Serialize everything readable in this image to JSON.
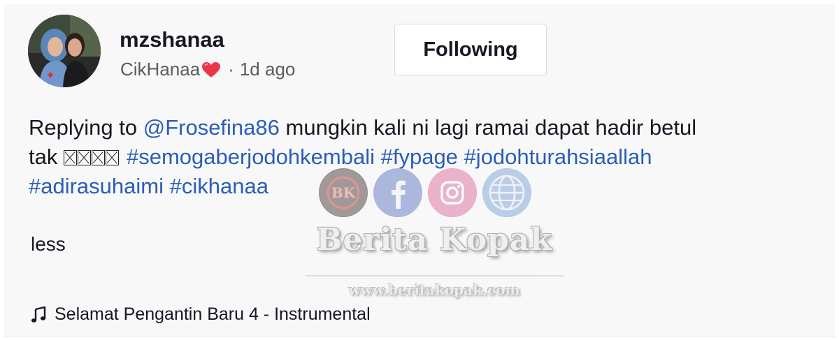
{
  "post": {
    "username": "mzshanaa",
    "display_name": "CikHanaa",
    "separator": "·",
    "time_ago": "1d ago",
    "follow_label": "Following"
  },
  "caption": {
    "line1": [
      {
        "type": "text",
        "text": "Replying to "
      },
      {
        "type": "mention",
        "text": "@Frosefina86"
      },
      {
        "type": "text",
        "text": " mungkin kali ni lagi ramai dapat hadir betul"
      }
    ],
    "line2_prefix": "tak ",
    "line2": [
      {
        "type": "hashtag",
        "text": "#semogaberjodohkembali"
      },
      {
        "type": "hashtag",
        "text": "#fypage"
      },
      {
        "type": "hashtag",
        "text": "#jodohturahsiaallah"
      }
    ],
    "line3": [
      {
        "type": "hashtag",
        "text": "#adirasuhaimi"
      },
      {
        "type": "hashtag",
        "text": "#cikhanaa"
      }
    ]
  },
  "less_label": "less",
  "music": {
    "icon": "music-note-icon",
    "title": "Selamat Pengantin Baru 4 - Instrumental"
  },
  "watermark": {
    "brand": "Berita Kopak",
    "url": "www.beritakopak.com",
    "badge": "BK"
  },
  "colors": {
    "link": "#2b5db8",
    "heart": "#e8374a",
    "text": "#161823",
    "muted": "#5c5c5c"
  }
}
